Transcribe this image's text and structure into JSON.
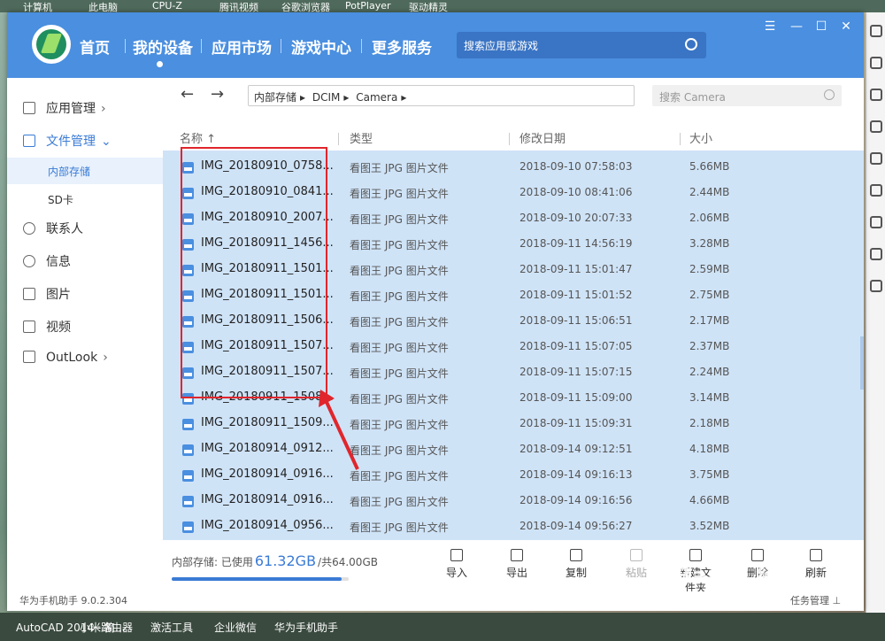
{
  "desktop": {
    "top_strip": [
      "计算机",
      "此电脑",
      "CPU-Z",
      "腾讯视频",
      "谷歌浏览器",
      "PotPlayer",
      "驱动精灵"
    ],
    "taskbar": [
      "AutoCAD 2014 - 简...",
      "小米路由器",
      "激活工具",
      "企业微信",
      "华为手机助手"
    ]
  },
  "app": {
    "nav": [
      "首页",
      "我的设备",
      "应用市场",
      "游戏中心",
      "更多服务"
    ],
    "active_nav": "我的设备",
    "search_placeholder": "搜索应用或游戏",
    "window_controls": [
      "☰",
      "—",
      "☐",
      "✕"
    ],
    "version": "华为手机助手 9.0.2.304",
    "tasks_label": "任务管理"
  },
  "sidebar": {
    "items": [
      {
        "label": "应用管理",
        "icon": "grid-icon",
        "chevron": "›"
      },
      {
        "label": "文件管理",
        "icon": "folder-icon",
        "chevron": "⌄"
      },
      {
        "label": "内部存储"
      },
      {
        "label": "SD卡"
      },
      {
        "label": "联系人",
        "icon": "contact-icon"
      },
      {
        "label": "信息",
        "icon": "message-icon"
      },
      {
        "label": "图片",
        "icon": "image-icon"
      },
      {
        "label": "视频",
        "icon": "video-icon"
      },
      {
        "label": "OutLook",
        "icon": "mail-icon",
        "chevron": "›"
      }
    ],
    "active_color": "#3a7bd5"
  },
  "filebrowser": {
    "back": "←",
    "forward": "→",
    "path": [
      "内部存储",
      "DCIM",
      "Camera"
    ],
    "path_sep": "▸",
    "search_placeholder": "搜索 Camera",
    "columns": {
      "name": "名称 ↑",
      "type": "类型",
      "date": "修改日期",
      "size": "大小"
    },
    "rows": [
      {
        "name": "IMG_20180910_0758...",
        "type": "看图王 JPG 图片文件",
        "date": "2018-09-10 07:58:03",
        "size": "5.66MB"
      },
      {
        "name": "IMG_20180910_0841...",
        "type": "看图王 JPG 图片文件",
        "date": "2018-09-10 08:41:06",
        "size": "2.44MB"
      },
      {
        "name": "IMG_20180910_2007...",
        "type": "看图王 JPG 图片文件",
        "date": "2018-09-10 20:07:33",
        "size": "2.06MB"
      },
      {
        "name": "IMG_20180911_1456...",
        "type": "看图王 JPG 图片文件",
        "date": "2018-09-11 14:56:19",
        "size": "3.28MB"
      },
      {
        "name": "IMG_20180911_1501...",
        "type": "看图王 JPG 图片文件",
        "date": "2018-09-11 15:01:47",
        "size": "2.59MB"
      },
      {
        "name": "IMG_20180911_1501...",
        "type": "看图王 JPG 图片文件",
        "date": "2018-09-11 15:01:52",
        "size": "2.75MB"
      },
      {
        "name": "IMG_20180911_1506...",
        "type": "看图王 JPG 图片文件",
        "date": "2018-09-11 15:06:51",
        "size": "2.17MB"
      },
      {
        "name": "IMG_20180911_1507...",
        "type": "看图王 JPG 图片文件",
        "date": "2018-09-11 15:07:05",
        "size": "2.37MB"
      },
      {
        "name": "IMG_20180911_1507...",
        "type": "看图王 JPG 图片文件",
        "date": "2018-09-11 15:07:15",
        "size": "2.24MB"
      },
      {
        "name": "IMG_20180911_1508...",
        "type": "看图王 JPG 图片文件",
        "date": "2018-09-11 15:09:00",
        "size": "3.14MB"
      },
      {
        "name": "IMG_20180911_1509...",
        "type": "看图王 JPG 图片文件",
        "date": "2018-09-11 15:09:31",
        "size": "2.18MB"
      },
      {
        "name": "IMG_20180914_0912...",
        "type": "看图王 JPG 图片文件",
        "date": "2018-09-14 09:12:51",
        "size": "4.18MB"
      },
      {
        "name": "IMG_20180914_0916...",
        "type": "看图王 JPG 图片文件",
        "date": "2018-09-14 09:16:13",
        "size": "3.75MB"
      },
      {
        "name": "IMG_20180914_0916...",
        "type": "看图王 JPG 图片文件",
        "date": "2018-09-14 09:16:56",
        "size": "4.66MB"
      },
      {
        "name": "IMG_20180914_0956...",
        "type": "看图王 JPG 图片文件",
        "date": "2018-09-14 09:56:27",
        "size": "3.52MB"
      }
    ],
    "selection_color": "#cfe3f7",
    "highlight_color": "#e0262c"
  },
  "storage": {
    "prefix": "内部存储: 已使用",
    "used": "61.32GB",
    "total": "/共64.00GB",
    "used_fraction": 0.958
  },
  "toolbar": [
    {
      "label": "导入",
      "icon": "import-icon",
      "enabled": true
    },
    {
      "label": "导出",
      "icon": "export-icon",
      "enabled": true
    },
    {
      "label": "复制",
      "icon": "copy-icon",
      "enabled": true
    },
    {
      "label": "粘贴",
      "icon": "paste-icon",
      "enabled": false
    },
    {
      "label": "新建文件夹",
      "icon": "new-folder-icon",
      "enabled": true
    },
    {
      "label": "删除",
      "icon": "delete-icon",
      "enabled": true
    },
    {
      "label": "刷新",
      "icon": "refresh-icon",
      "enabled": true
    }
  ],
  "watermark": {
    "logo": "Baidu 经验",
    "url": "jingyan.baidu.com"
  }
}
